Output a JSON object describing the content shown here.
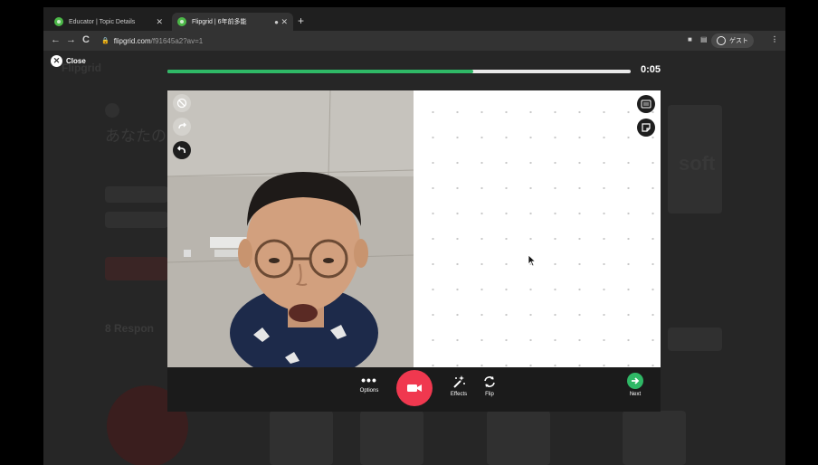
{
  "browser": {
    "tabs": [
      {
        "title": "Educator | Topic Details"
      },
      {
        "title": "Flipgrid | 6年前多能"
      }
    ],
    "url_host": "flipgrid.com",
    "url_path": "/f91645a2?av=1",
    "profile_label": "ゲスト"
  },
  "page_background": {
    "brand_text": "Flipgrid",
    "faded_heading": "あなたの",
    "responses_label": "8 Respon",
    "microsoft_text": "soft"
  },
  "recorder": {
    "close_label": "Close",
    "timer": "0:05",
    "progress_fraction": 0.66,
    "controls": {
      "options_label": "Options",
      "effects_label": "Effects",
      "flip_label": "Flip",
      "next_label": "Next"
    },
    "icons": {
      "record": "record-camera-icon",
      "options": "more-dots-icon",
      "effects": "magic-wand-icon",
      "flip": "flip-camera-icon",
      "next": "arrow-right-icon",
      "keyboard": "keyboard-icon",
      "sticky": "sticky-note-icon",
      "undo": "undo-icon",
      "no_draw": "no-draw-icon",
      "redo": "redo-icon"
    }
  },
  "colors": {
    "accent_green": "#2fb866",
    "record_red": "#f0384f"
  }
}
